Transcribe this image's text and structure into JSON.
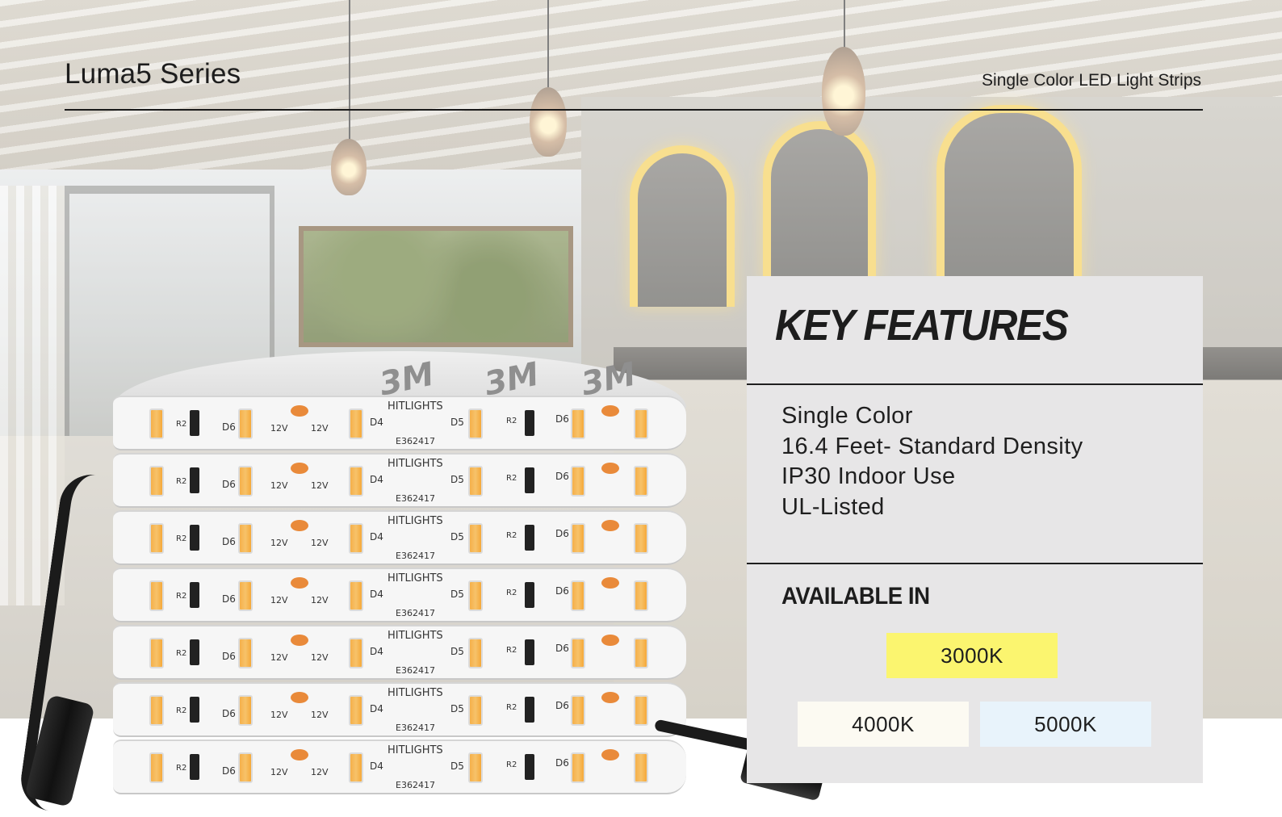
{
  "header": {
    "title": "Luma5 Series",
    "subtitle": "Single Color LED Light Strips"
  },
  "product_image": {
    "brand_label": "HITLIGHTS",
    "tape_label": "3M",
    "voltage_label": "12V",
    "cert_code": "E362417",
    "component_labels": [
      "D4",
      "D5",
      "D6",
      "R2"
    ]
  },
  "key_features": {
    "title": "KEY FEATURES",
    "items": [
      "Single Color",
      "16.4 Feet- Standard Density",
      "IP30 Indoor Use",
      "UL-Listed"
    ]
  },
  "available_in": {
    "title": "AVAILABLE IN",
    "options": [
      {
        "label": "3000K",
        "color": "#fbf56f"
      },
      {
        "label": "4000K",
        "color": "#fcfaf2"
      },
      {
        "label": "5000K",
        "color": "#e8f3fb"
      }
    ]
  },
  "colors": {
    "rule": "#1a1a1a",
    "panel_bg": "#e7e6e7",
    "text": "#1d1d1d",
    "arch_glow": "#f6d56a",
    "led_amber": "#f5b04a"
  }
}
